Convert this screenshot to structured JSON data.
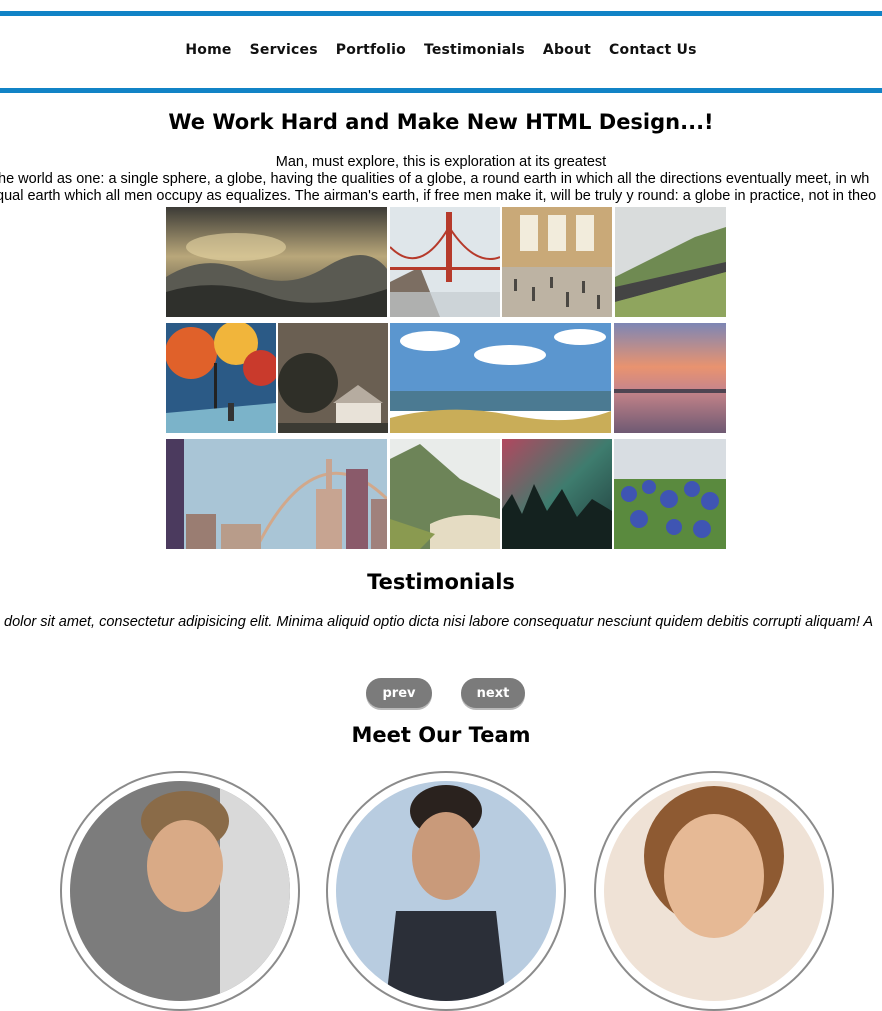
{
  "nav": {
    "items": [
      "Home",
      "Services",
      "Portfolio",
      "Testimonials",
      "About",
      "Contact Us"
    ]
  },
  "hero": {
    "title": "We Work Hard and Make New HTML Design...!",
    "line1": "Man, must explore, this is exploration at its greatest",
    "line2": "the world as one: a single sphere, a globe, having the qualities of a globe, a round earth in which all the directions eventually meet, in wh",
    "line3": "qual earth which all men occupy as equalizes. The airman's earth, if free men make it, will be truly y round: a globe in practice, not in theo"
  },
  "gallery": {
    "images": [
      "stormy-sea-painting",
      "golden-gate-bridge",
      "grand-central-station",
      "mountain-road",
      "autumn-street-painting",
      "house-under-trees",
      "ocean-shore-clouds",
      "sunset-lake",
      "city-rainbow",
      "mountain-beach",
      "northern-lights",
      "bluebonnet-flowers"
    ]
  },
  "testimonials": {
    "title": "Testimonials",
    "quote": "dolor sit amet, consectetur adipisicing elit. Minima aliquid optio dicta nisi labore consequatur nesciunt quidem debitis corrupti aliquam! A",
    "prev_label": "prev",
    "next_label": "next"
  },
  "team": {
    "title": "Meet Our Team",
    "members": [
      "team-member-1",
      "team-member-2",
      "team-member-3"
    ]
  },
  "colors": {
    "accent": "#1183c6",
    "button": "#7b7b7b"
  }
}
